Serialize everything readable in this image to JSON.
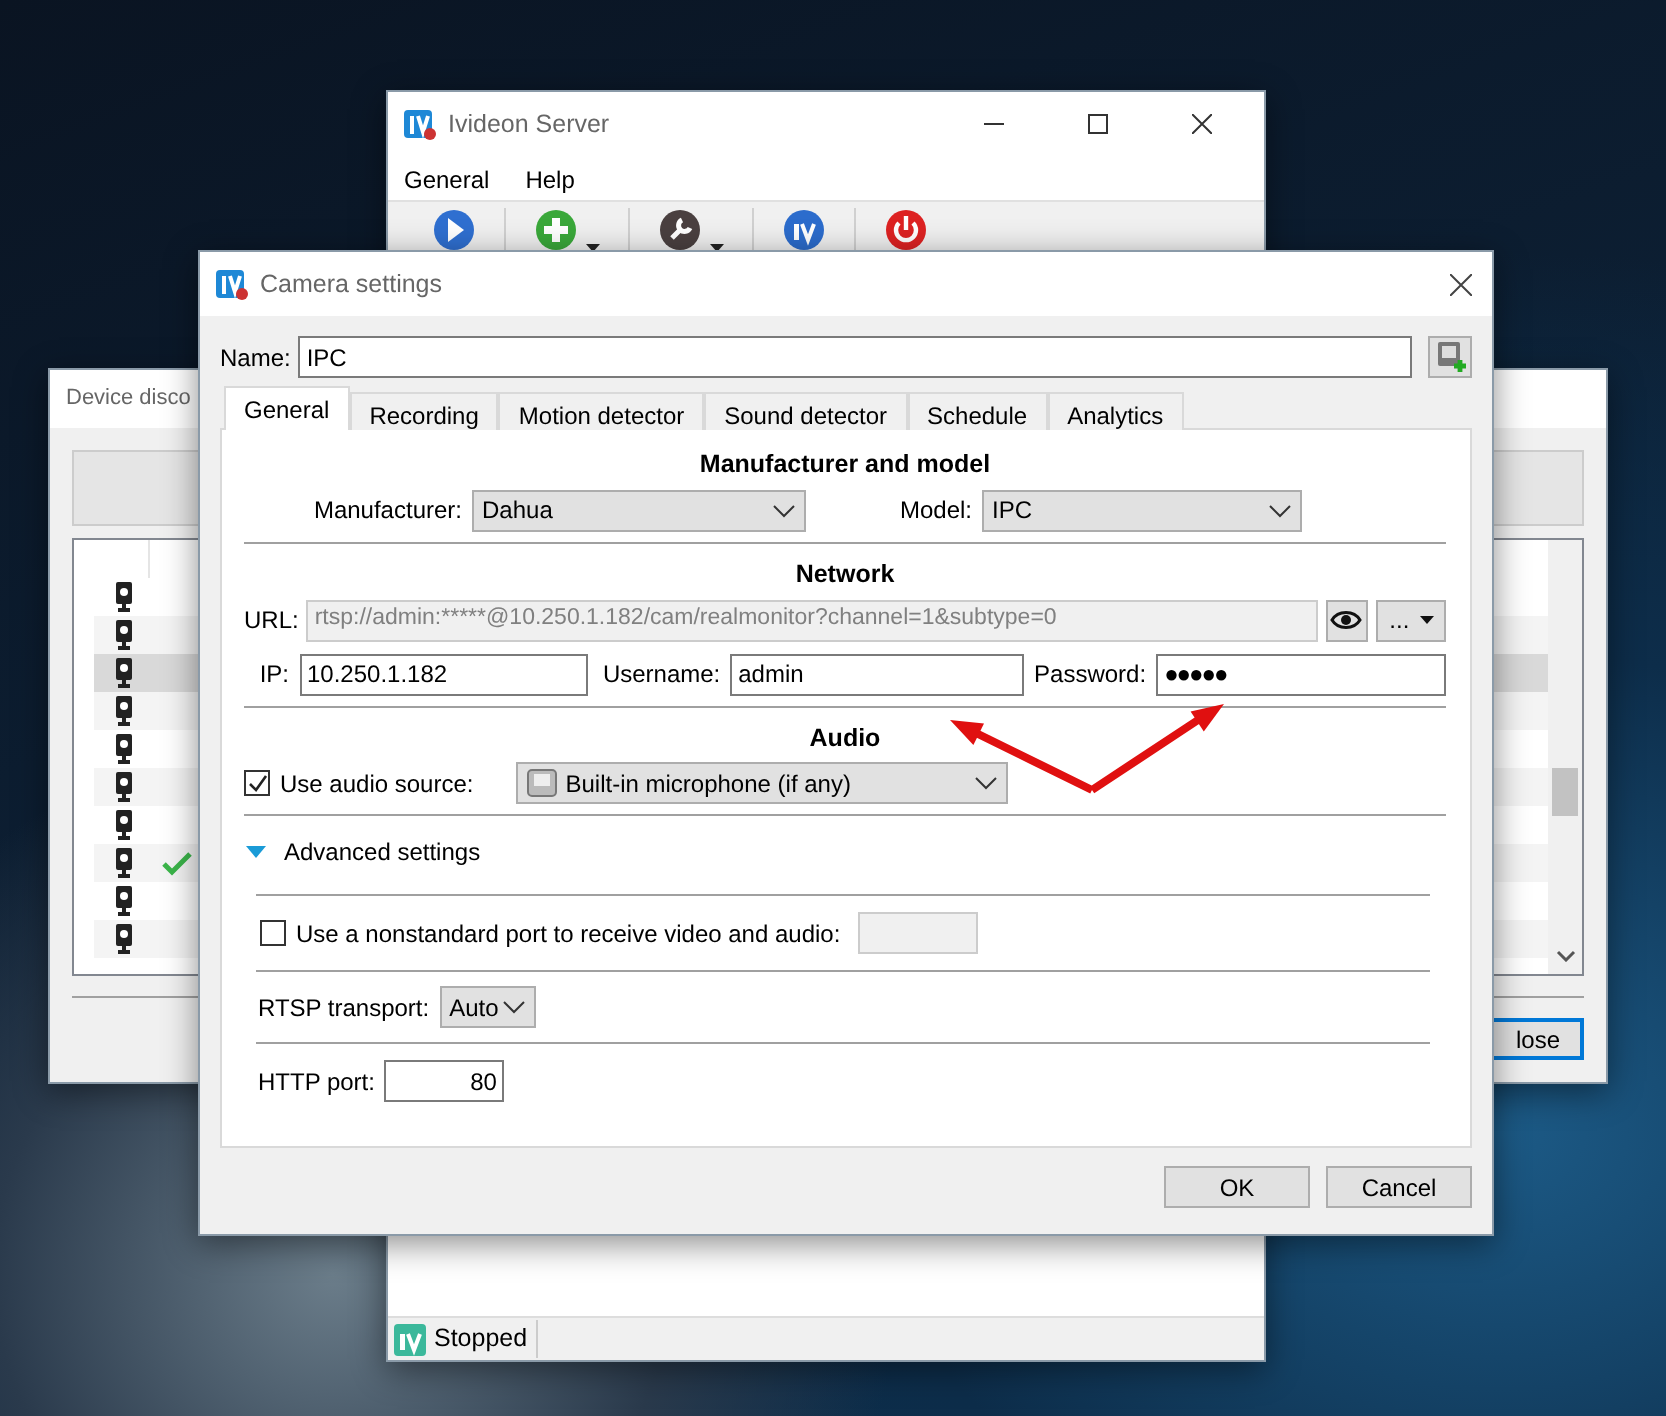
{
  "server_window": {
    "title": "Ivideon Server",
    "menu": [
      "General",
      "Help"
    ],
    "status": "Stopped"
  },
  "discovery_window": {
    "title": "Device disco",
    "rows": [
      {
        "selected": false,
        "found": false
      },
      {
        "selected": false,
        "found": false
      },
      {
        "selected": true,
        "found": false
      },
      {
        "selected": false,
        "found": false
      },
      {
        "selected": false,
        "found": false
      },
      {
        "selected": false,
        "found": false
      },
      {
        "selected": false,
        "found": false
      },
      {
        "selected": false,
        "found": true
      },
      {
        "selected": false,
        "found": false
      },
      {
        "selected": false,
        "found": false
      }
    ],
    "close_button": "lose"
  },
  "camera_settings": {
    "title": "Camera settings",
    "name": {
      "label": "Name:",
      "value": "IPC"
    },
    "tabs": [
      {
        "label": "General",
        "selected": true
      },
      {
        "label": "Recording",
        "selected": false
      },
      {
        "label": "Motion detector",
        "selected": false
      },
      {
        "label": "Sound detector",
        "selected": false
      },
      {
        "label": "Schedule",
        "selected": false
      },
      {
        "label": "Analytics",
        "selected": false
      }
    ],
    "manufacturer_heading": "Manufacturer and model",
    "manufacturer": {
      "label": "Manufacturer:",
      "value": "Dahua"
    },
    "model": {
      "label": "Model:",
      "value": "IPC"
    },
    "network_heading": "Network",
    "url": {
      "label": "URL:",
      "value": "rtsp://admin:*****@10.250.1.182/cam/realmonitor?channel=1&subtype=0",
      "disabled": true
    },
    "url_menu_button": "...",
    "ip": {
      "label": "IP:",
      "value": "10.250.1.182"
    },
    "username": {
      "label": "Username:",
      "value": "admin"
    },
    "password": {
      "label": "Password:",
      "value": "●●●●●"
    },
    "audio_heading": "Audio",
    "use_audio": {
      "label": "Use audio source:",
      "checked": true
    },
    "audio_source": {
      "value": "Built-in microphone (if any)"
    },
    "advanced": {
      "label": "Advanced settings",
      "expanded": true
    },
    "nonstandard_port": {
      "label": "Use a nonstandard port to receive video and audio:",
      "checked": false,
      "field_disabled": true
    },
    "rtsp_transport": {
      "label": "RTSP transport:",
      "value": "Auto"
    },
    "http_port": {
      "label": "HTTP port:",
      "value": "80"
    },
    "buttons": [
      "OK",
      "Cancel"
    ]
  }
}
